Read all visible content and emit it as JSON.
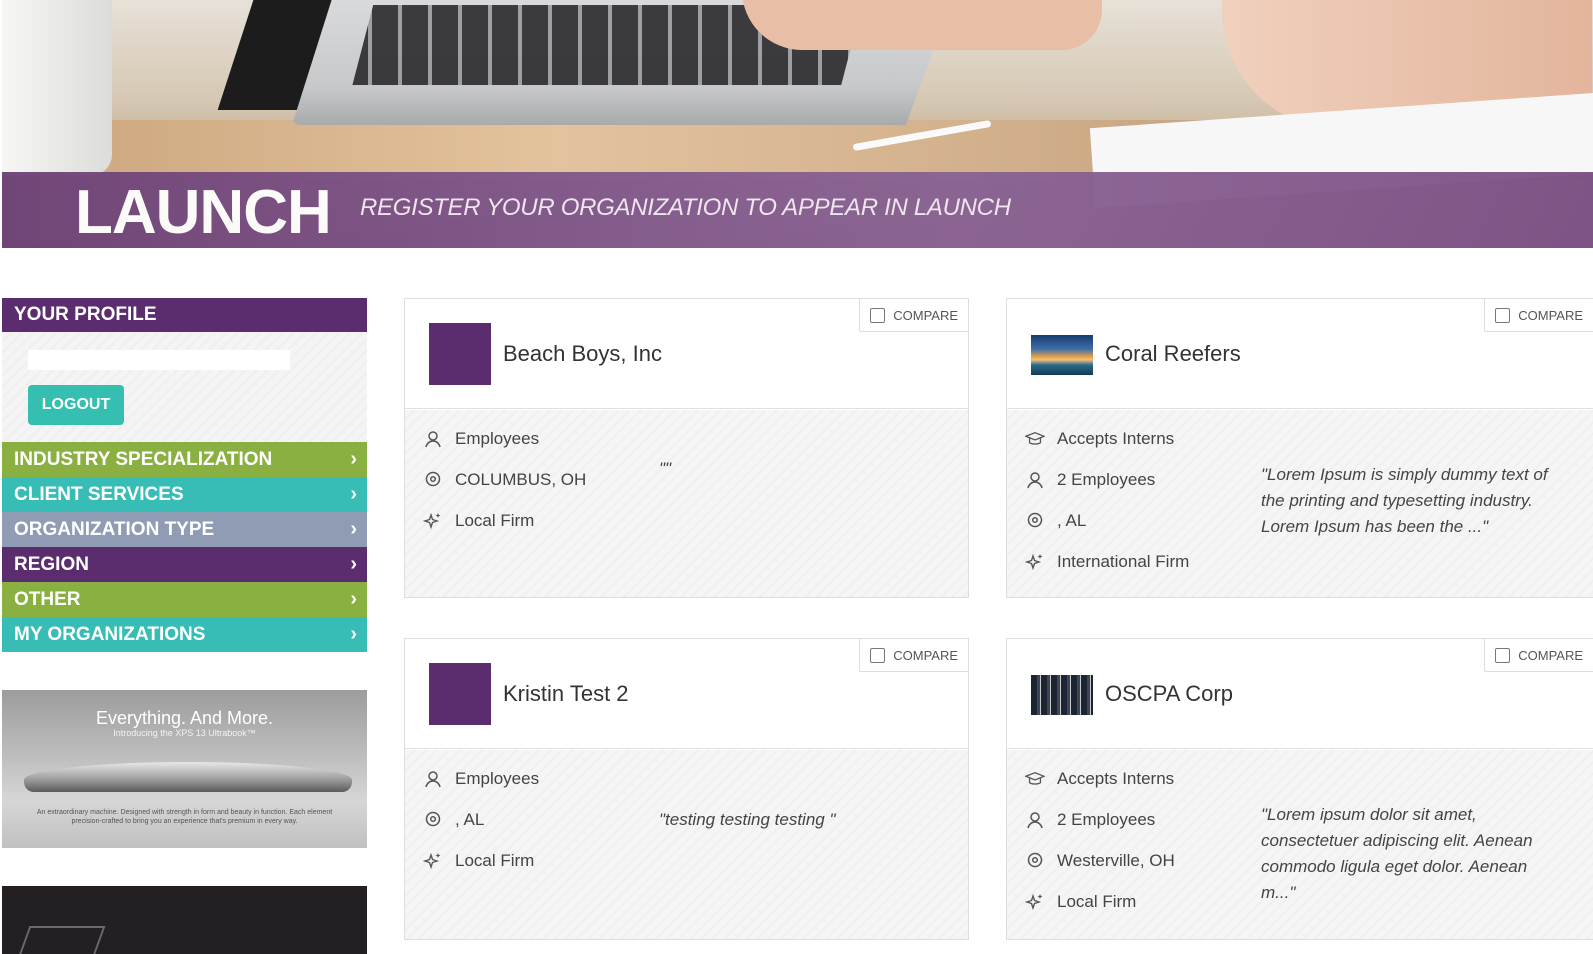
{
  "banner": {
    "logo": "LAUNCH",
    "tagline": "REGISTER YOUR ORGANIZATION TO APPEAR IN LAUNCH"
  },
  "sidebar": {
    "profile_title": "YOUR PROFILE",
    "profile_input_value": "",
    "logout_label": "LOGOUT",
    "items": [
      {
        "label": "INDUSTRY SPECIALIZATION",
        "color": "#8ab041"
      },
      {
        "label": "CLIENT SERVICES",
        "color": "#37bdb5"
      },
      {
        "label": "ORGANIZATION TYPE",
        "color": "#8f9cb3"
      },
      {
        "label": "REGION",
        "color": "#5b2d6e"
      },
      {
        "label": "OTHER",
        "color": "#8ab041"
      },
      {
        "label": "MY ORGANIZATIONS",
        "color": "#37bdb5"
      }
    ],
    "ad": {
      "title": "Everything. And More.",
      "subtitle": "Introducing the XPS 13 Ultrabook™",
      "fine_print": "An extraordinary machine. Designed with strength in form and beauty in function. Each element precision-crafted to bring you an experience that's premium in every way."
    }
  },
  "compare_label": "COMPARE",
  "cards": [
    {
      "name": "Beach Boys, Inc",
      "logo": "purple-square",
      "employees": "Employees",
      "location": "COLUMBUS, OH",
      "firm_type": "Local Firm",
      "quote": "\"\""
    },
    {
      "name": "Coral Reefers",
      "logo": "wave-image",
      "interns": "Accepts Interns",
      "employees": "2 Employees",
      "location": ", AL",
      "firm_type": "International Firm",
      "quote": "\"Lorem Ipsum is simply dummy text of the printing and typesetting industry. Lorem Ipsum has been the ...\""
    },
    {
      "name": "Kristin Test 2",
      "logo": "purple-square",
      "employees": "Employees",
      "location": ", AL",
      "firm_type": "Local Firm",
      "quote": "\"testing testing testing \""
    },
    {
      "name": "OSCPA Corp",
      "logo": "team-image",
      "interns": "Accepts Interns",
      "employees": "2 Employees",
      "location": "Westerville, OH",
      "firm_type": "Local Firm",
      "quote": "\"Lorem ipsum dolor sit amet, consectetuer adipiscing elit. Aenean commodo ligula eget dolor. Aenean m...\""
    }
  ],
  "colors": {
    "brand_purple": "#5b2d6e",
    "teal": "#34bfb0",
    "green": "#8ab041",
    "slate": "#8f9cb3"
  }
}
